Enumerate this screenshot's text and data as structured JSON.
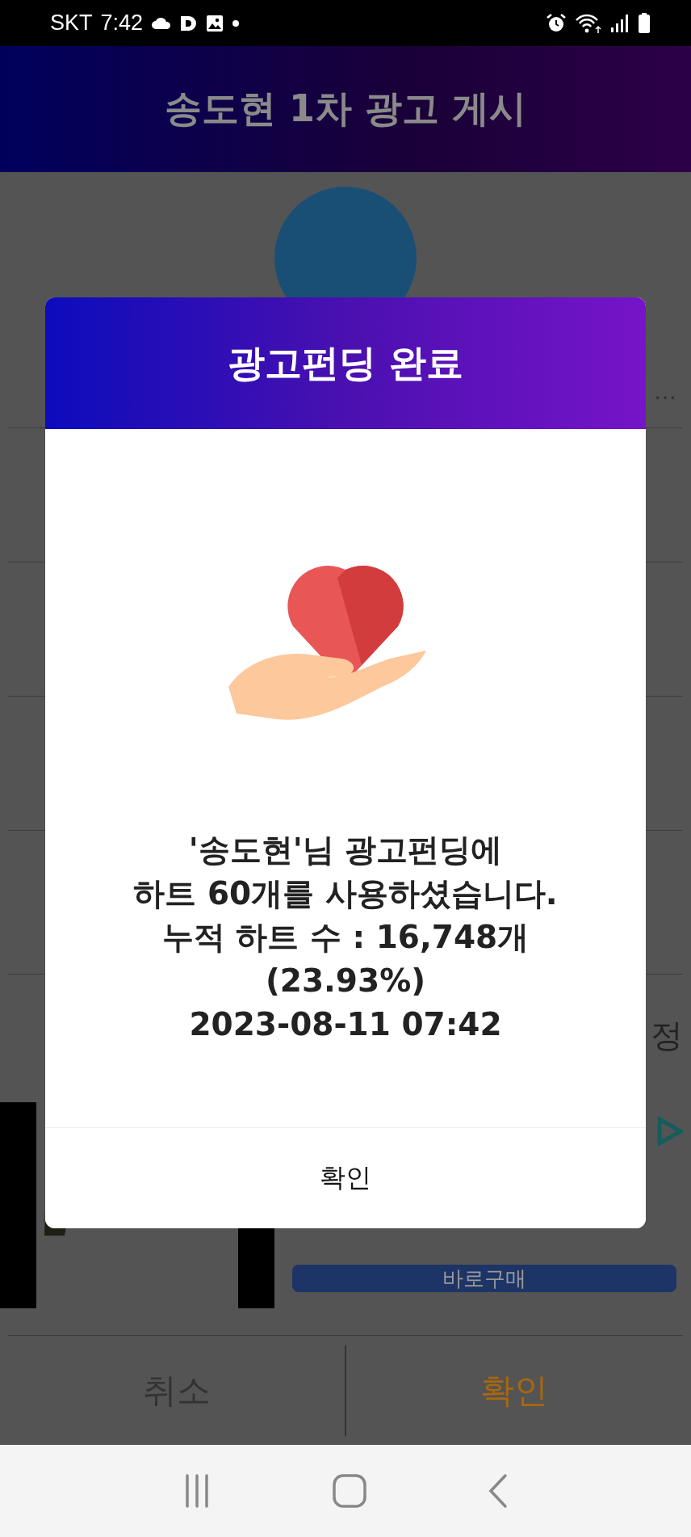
{
  "status_bar": {
    "carrier": "SKT",
    "time": "7:42"
  },
  "header": {
    "title": "송도현 1차 광고 게시"
  },
  "background": {
    "first_row_trailing": "…",
    "last_row_trailing": "정"
  },
  "ad": {
    "button": "바로구매"
  },
  "dialog": {
    "title": "광고펀딩 완료",
    "message_lines": [
      "'송도현'님 광고펀딩에",
      "하트 60개를 사용하셨습니다.",
      "누적 하트 수 : 16,748개",
      "(23.93%)",
      "2023-08-11 07:42"
    ],
    "button": "확인"
  },
  "bottom_bar": {
    "buttons": [
      {
        "label": "취소",
        "kind": "cancel"
      },
      {
        "label": "확인",
        "kind": "confirm"
      }
    ]
  }
}
